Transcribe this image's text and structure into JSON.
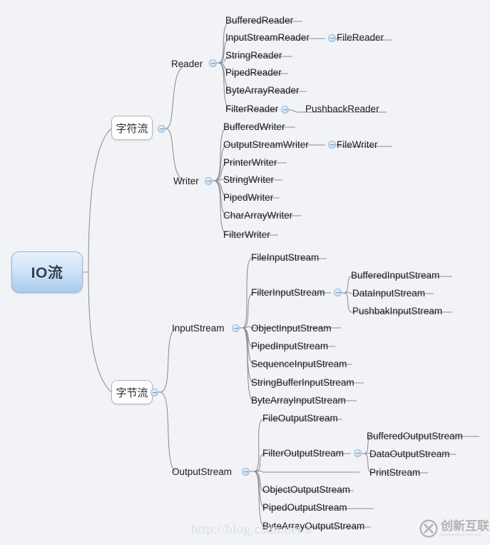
{
  "diagram": {
    "title": "IO流",
    "type": "mindmap",
    "background_color": "#f2f3f7",
    "root": {
      "label": "IO流",
      "accent_color": "#a9cbef"
    },
    "branches": [
      {
        "label": "字符流",
        "children": [
          {
            "label": "Reader",
            "collapsible": true,
            "children": [
              {
                "label": "BufferedReader"
              },
              {
                "label": "InputStreamReader",
                "collapsible": true,
                "children": [
                  {
                    "label": "FileReader"
                  }
                ]
              },
              {
                "label": "StringReader"
              },
              {
                "label": "PipedReader"
              },
              {
                "label": "ByteArrayReader"
              },
              {
                "label": "FilterReader",
                "collapsible": true,
                "children": [
                  {
                    "label": "PushbackReader"
                  }
                ]
              }
            ]
          },
          {
            "label": "Writer",
            "collapsible": true,
            "children": [
              {
                "label": "BufferedWriter"
              },
              {
                "label": "OutputStreamWriter",
                "collapsible": true,
                "children": [
                  {
                    "label": "FileWriter"
                  }
                ]
              },
              {
                "label": "PrinterWriter"
              },
              {
                "label": "StringWriter"
              },
              {
                "label": "PipedWriter"
              },
              {
                "label": "CharArrayWriter"
              },
              {
                "label": "FilterWriter"
              }
            ]
          }
        ]
      },
      {
        "label": "字节流",
        "children": [
          {
            "label": "InputStream",
            "collapsible": true,
            "children": [
              {
                "label": "FileInputStream"
              },
              {
                "label": "FilterInputStream",
                "collapsible": true,
                "children": [
                  {
                    "label": "BufferedInputStream"
                  },
                  {
                    "label": "DataInputStream"
                  },
                  {
                    "label": "PushbakInputStream"
                  }
                ]
              },
              {
                "label": "ObjectInputStream"
              },
              {
                "label": "PipedInputStream"
              },
              {
                "label": "SequenceInputStream"
              },
              {
                "label": "StringBufferInputStream"
              },
              {
                "label": "ByteArrayInputStream"
              }
            ]
          },
          {
            "label": "OutputStream",
            "collapsible": true,
            "children": [
              {
                "label": "FileOutputStream"
              },
              {
                "label": "FilterOutputStream",
                "collapsible": true,
                "children": [
                  {
                    "label": "BufferedOutputStream"
                  },
                  {
                    "label": "DataOutputStream"
                  },
                  {
                    "label": "PrintStream"
                  }
                ]
              },
              {
                "label": "ObjectOutputStream"
              },
              {
                "label": "PipedOutputStream"
              },
              {
                "label": "ByteArrayOutputStream"
              }
            ]
          }
        ]
      }
    ]
  },
  "nodes": {
    "char_stream": "字符流",
    "byte_stream": "字节流",
    "reader": "Reader",
    "writer": "Writer",
    "input_stream": "InputStream",
    "output_stream": "OutputStream",
    "buffered_reader": "BufferedReader",
    "input_stream_reader": "InputStreamReader",
    "file_reader": "FileReader",
    "string_reader": "StringReader",
    "piped_reader": "PipedReader",
    "byte_array_reader": "ByteArrayReader",
    "filter_reader": "FilterReader",
    "pushback_reader": "PushbackReader",
    "buffered_writer": "BufferedWriter",
    "output_stream_writer": "OutputStreamWriter",
    "file_writer": "FileWriter",
    "printer_writer": "PrinterWriter",
    "string_writer": "StringWriter",
    "piped_writer": "PipedWriter",
    "char_array_writer": "CharArrayWriter",
    "filter_writer": "FilterWriter",
    "file_input_stream": "FileInputStream",
    "filter_input_stream": "FilterInputStream",
    "buffered_input_stream": "BufferedInputStream",
    "data_input_stream": "DataInputStream",
    "pushbak_input_stream": "PushbakInputStream",
    "object_input_stream": "ObjectInputStream",
    "piped_input_stream": "PipedInputStream",
    "sequence_input_stream": "SequenceInputStream",
    "string_buffer_input_stream": "StringBufferInputStream",
    "byte_array_input_stream": "ByteArrayInputStream",
    "file_output_stream": "FileOutputStream",
    "filter_output_stream": "FilterOutputStream",
    "buffered_output_stream": "BufferedOutputStream",
    "data_output_stream": "DataOutputStream",
    "print_stream": "PrintStream",
    "object_output_stream": "ObjectOutputStream",
    "piped_output_stream": "PipedOutputStream",
    "byte_array_output_stream": "ByteArrayOutputStream"
  },
  "watermark": {
    "text": "http://blog.csdn.net/a"
  },
  "logo": {
    "name": "创新互联",
    "pinyin": "CHUANGXIN HULIAN"
  }
}
